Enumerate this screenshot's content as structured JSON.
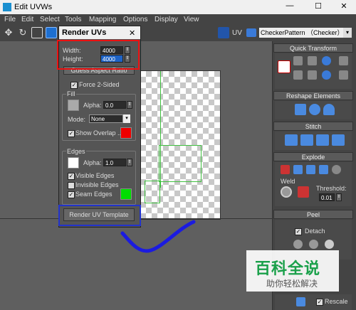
{
  "window": {
    "title": "Edit UVWs",
    "minimize": "—",
    "maximize": "☐",
    "close": "✕"
  },
  "menu": [
    "File",
    "Edit",
    "Select",
    "Tools",
    "Mapping",
    "Options",
    "Display",
    "View"
  ],
  "toolbar": {
    "uv_label": "UV",
    "texture_select": "CheckerPattern （Checker）"
  },
  "dialog": {
    "title": "Render UVs",
    "close": "✕",
    "width_label": "Width:",
    "width_value": "4000",
    "height_label": "Height:",
    "height_value": "4000",
    "guess_aspect": "Guess Aspect Ratio",
    "force_2sided": "Force 2-Sided",
    "fill": {
      "label": "Fill",
      "alpha_label": "Alpha:",
      "alpha_value": "0.0",
      "mode_label": "Mode:",
      "mode_value": "None",
      "show_overlap": "Show Overlap ...",
      "overlap_color": "#ee0000"
    },
    "edges": {
      "label": "Edges",
      "alpha_label": "Alpha:",
      "alpha_value": "1.0",
      "visible_edges": "Visible Edges",
      "invisible_edges": "Invisible Edges",
      "seam_edges": "Seam Edges",
      "seam_color": "#00dd00"
    },
    "render_button": "Render UV Template"
  },
  "right_panel": {
    "quick_transform": "Quick Transform",
    "reshape_elements": "Reshape Elements",
    "stitch": "Stitch",
    "explode": "Explode",
    "weld": "Weld",
    "threshold_label": "Threshold:",
    "threshold_value": "0.01",
    "peel": "Peel",
    "detach": "Detach",
    "rescale": "Rescale"
  },
  "watermark": {
    "title": "百科全说",
    "subtitle": "助你轻松解决"
  }
}
